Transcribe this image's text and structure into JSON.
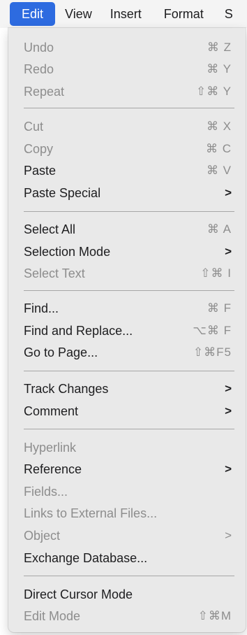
{
  "menubar": {
    "edit": "Edit",
    "view": "View",
    "insert": "Insert",
    "format": "Format",
    "more": "S"
  },
  "menu": {
    "undo": {
      "label": "Undo",
      "shortcut": "⌘ Z"
    },
    "redo": {
      "label": "Redo",
      "shortcut": "⌘ Y"
    },
    "repeat": {
      "label": "Repeat",
      "shortcut": "⇧⌘ Y"
    },
    "cut": {
      "label": "Cut",
      "shortcut": "⌘ X"
    },
    "copy": {
      "label": "Copy",
      "shortcut": "⌘ C"
    },
    "paste": {
      "label": "Paste",
      "shortcut": "⌘ V"
    },
    "paste_special": {
      "label": "Paste Special",
      "chevron": ">"
    },
    "select_all": {
      "label": "Select All",
      "shortcut": "⌘ A"
    },
    "selection_mode": {
      "label": "Selection Mode",
      "chevron": ">"
    },
    "select_text": {
      "label": "Select Text",
      "shortcut": "⇧⌘ I"
    },
    "find": {
      "label": "Find...",
      "shortcut": "⌘ F"
    },
    "find_replace": {
      "label": "Find and Replace...",
      "shortcut": "⌥⌘ F"
    },
    "go_to_page": {
      "label": "Go to Page...",
      "shortcut": "⇧⌘F5"
    },
    "track_changes": {
      "label": "Track Changes",
      "chevron": ">"
    },
    "comment": {
      "label": "Comment",
      "chevron": ">"
    },
    "hyperlink": {
      "label": "Hyperlink"
    },
    "reference": {
      "label": "Reference",
      "chevron": ">"
    },
    "fields": {
      "label": "Fields..."
    },
    "links_external": {
      "label": "Links to External Files..."
    },
    "object": {
      "label": "Object",
      "chevron": ">"
    },
    "exchange_db": {
      "label": "Exchange Database..."
    },
    "direct_cursor": {
      "label": "Direct Cursor Mode"
    },
    "edit_mode": {
      "label": "Edit Mode",
      "shortcut": "⇧⌘M"
    }
  }
}
